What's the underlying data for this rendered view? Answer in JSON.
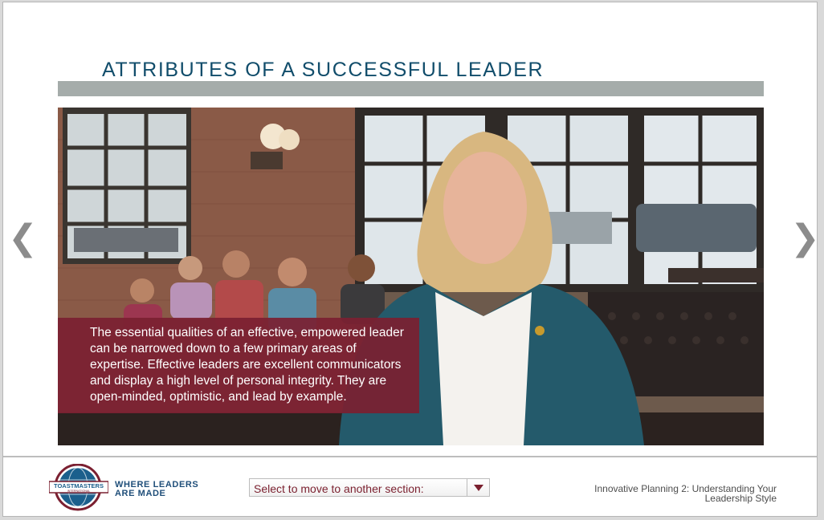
{
  "slide": {
    "title": "ATTRIBUTES OF A SUCCESSFUL LEADER",
    "caption": "The essential qualities of an effective, empowered leader can be narrowed down to a few primary areas of expertise. Effective leaders are excellent communicators and display a high level of personal integrity. They are open-minded, optimistic, and lead by example."
  },
  "nav": {
    "prev_glyph": "❮",
    "next_glyph": "❯"
  },
  "footer": {
    "logo_text": "TOASTMASTERS",
    "logo_subtext": "INTERNATIONAL",
    "tagline_line1": "WHERE LEADERS",
    "tagline_line2": "ARE MADE",
    "section_select_label": "Select to move to another section:",
    "course_title": "Innovative Planning 2: Understanding Your Leadership Style"
  },
  "colors": {
    "title": "#114d6b",
    "title_bar": "#a5acaa",
    "caption_bg": "#7b2031",
    "select_text": "#7a1f2e",
    "tagline": "#1f4e79"
  }
}
